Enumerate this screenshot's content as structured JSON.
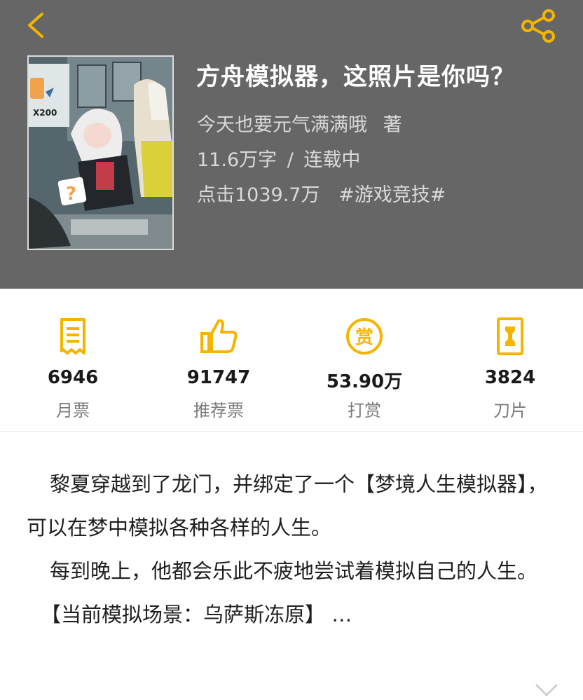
{
  "nav": {
    "back_icon": "chevron-left-icon",
    "share_icon": "share-icon",
    "accent": "#f5b400"
  },
  "book": {
    "title": "方舟模拟器，这照片是你吗？",
    "author": "今天也要元气满满哦",
    "author_suffix": "著",
    "words": "11.6万字",
    "separator": "/",
    "status": "连载中",
    "clicks": "点击1039.7万",
    "tag": "#游戏竞技#"
  },
  "cover": {
    "badge_text": "X200",
    "question_mark": "?"
  },
  "stats": [
    {
      "icon": "monthly-ticket-icon",
      "value": "6946",
      "label": "月票"
    },
    {
      "icon": "thumbs-up-icon",
      "value": "91747",
      "label": "推荐票"
    },
    {
      "icon": "reward-coin-icon",
      "value": "53.90万",
      "label": "打赏"
    },
    {
      "icon": "blade-card-icon",
      "value": "3824",
      "label": "刀片"
    }
  ],
  "coin_char": "赏",
  "synopsis": {
    "p1": "黎夏穿越到了龙门，并绑定了一个【梦境人生模拟器】，可以在梦中模拟各种各样的人生。",
    "p2": "每到晚上，他都会乐此不疲地尝试着模拟自己的人生。",
    "p3": "【当前模拟场景：乌萨斯冻原】 …",
    "expand_icon": "chevron-down-icon"
  }
}
